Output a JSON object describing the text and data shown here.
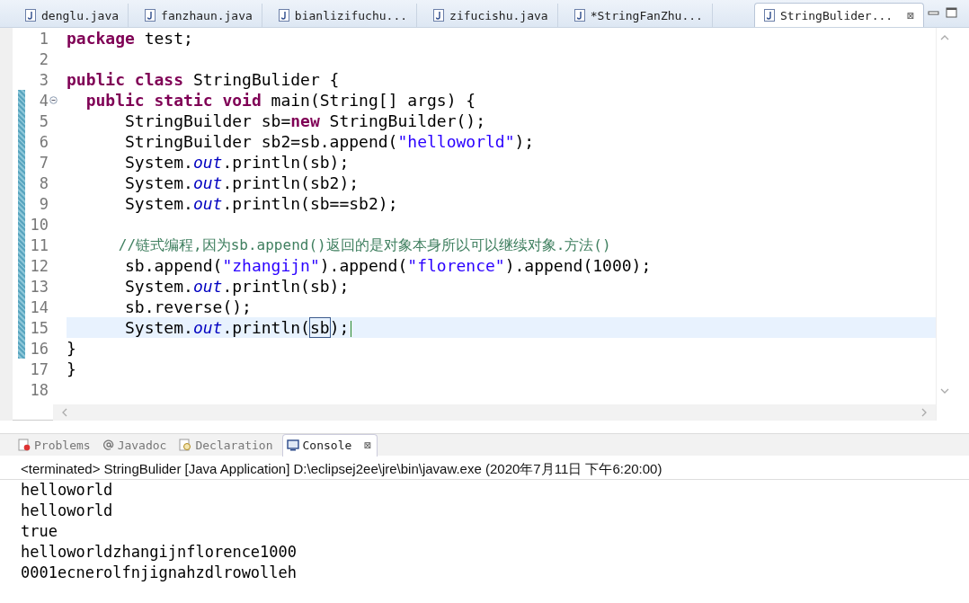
{
  "editor_tabs": [
    {
      "label": "denglu.java",
      "selected": false
    },
    {
      "label": "fanzhaun.java",
      "selected": false
    },
    {
      "label": "bianlizifuchu...",
      "selected": false
    },
    {
      "label": "zifucishu.java",
      "selected": false
    },
    {
      "label": "*StringFanZhu...",
      "selected": false
    },
    {
      "label": "StringBulider...",
      "selected": true,
      "close": "⊠"
    }
  ],
  "code_lines": [
    {
      "number": "1",
      "changed": false,
      "current": false,
      "foldable": false,
      "tokens": [
        {
          "kind": "keyword",
          "text": "package"
        },
        {
          "kind": "plain",
          "text": " test;"
        }
      ]
    },
    {
      "number": "2",
      "changed": false,
      "current": false,
      "foldable": false
    },
    {
      "number": "3",
      "changed": false,
      "current": false,
      "foldable": false,
      "tokens": [
        {
          "kind": "keyword",
          "text": "public class"
        },
        {
          "kind": "plain",
          "text": " StringBulider {"
        }
      ]
    },
    {
      "number": "4",
      "changed": true,
      "current": false,
      "foldable": true,
      "tokens": [
        {
          "kind": "keyword",
          "text": "  public static void"
        },
        {
          "kind": "plain",
          "text": " main(String[] args) {"
        }
      ]
    },
    {
      "number": "5",
      "changed": true,
      "current": false,
      "foldable": false,
      "tokens": [
        {
          "kind": "plain",
          "text": "      StringBuilder sb="
        },
        {
          "kind": "keyword",
          "text": "new"
        },
        {
          "kind": "plain",
          "text": " StringBuilder();"
        }
      ]
    },
    {
      "number": "6",
      "changed": true,
      "current": false,
      "foldable": false,
      "tokens": [
        {
          "kind": "plain",
          "text": "      StringBuilder sb2=sb.append("
        },
        {
          "kind": "string",
          "text": "\"helloworld\""
        },
        {
          "kind": "plain",
          "text": ");"
        }
      ]
    },
    {
      "number": "7",
      "changed": true,
      "current": false,
      "foldable": false,
      "tokens": [
        {
          "kind": "plain",
          "text": "      System."
        },
        {
          "kind": "field",
          "text": "out"
        },
        {
          "kind": "plain",
          "text": ".println(sb);"
        }
      ]
    },
    {
      "number": "8",
      "changed": true,
      "current": false,
      "foldable": false,
      "tokens": [
        {
          "kind": "plain",
          "text": "      System."
        },
        {
          "kind": "field",
          "text": "out"
        },
        {
          "kind": "plain",
          "text": ".println(sb2);"
        }
      ]
    },
    {
      "number": "9",
      "changed": true,
      "current": false,
      "foldable": false,
      "tokens": [
        {
          "kind": "plain",
          "text": "      System."
        },
        {
          "kind": "field",
          "text": "out"
        },
        {
          "kind": "plain",
          "text": ".println(sb==sb2);"
        }
      ]
    },
    {
      "number": "10",
      "changed": true,
      "current": false,
      "foldable": false
    },
    {
      "number": "11",
      "changed": true,
      "current": false,
      "foldable": false,
      "tokens": [
        {
          "kind": "comment",
          "text": "      //链式编程,因为sb.append()返回的是对象本身所以可以继续对象.方法()"
        }
      ]
    },
    {
      "number": "12",
      "changed": true,
      "current": false,
      "foldable": false,
      "tokens": [
        {
          "kind": "plain",
          "text": "      sb.append("
        },
        {
          "kind": "string",
          "text": "\"zhangijn\""
        },
        {
          "kind": "plain",
          "text": ").append("
        },
        {
          "kind": "string",
          "text": "\"florence\""
        },
        {
          "kind": "plain",
          "text": ").append(1000);"
        }
      ]
    },
    {
      "number": "13",
      "changed": true,
      "current": false,
      "foldable": false,
      "tokens": [
        {
          "kind": "plain",
          "text": "      System."
        },
        {
          "kind": "field",
          "text": "out"
        },
        {
          "kind": "plain",
          "text": ".println(sb);"
        }
      ]
    },
    {
      "number": "14",
      "changed": true,
      "current": false,
      "foldable": false,
      "tokens": [
        {
          "kind": "plain",
          "text": "      sb.reverse();"
        }
      ]
    },
    {
      "number": "15",
      "changed": true,
      "current": true,
      "foldable": false,
      "tokens": [
        {
          "kind": "plain",
          "text": "      System."
        },
        {
          "kind": "field",
          "text": "out"
        },
        {
          "kind": "plain",
          "text": ".println("
        },
        {
          "kind": "matched",
          "text": "sb"
        },
        {
          "kind": "plain",
          "text": ");"
        }
      ]
    },
    {
      "number": "16",
      "changed": true,
      "current": false,
      "foldable": false,
      "tokens": [
        {
          "kind": "plain",
          "text": "}"
        }
      ]
    },
    {
      "number": "17",
      "changed": false,
      "current": false,
      "foldable": false,
      "tokens": [
        {
          "kind": "plain",
          "text": "}"
        }
      ]
    },
    {
      "number": "18",
      "changed": false,
      "current": false,
      "foldable": false
    }
  ],
  "view_tabs": [
    {
      "label": "Problems",
      "kind": "problems",
      "selected": false
    },
    {
      "label": "Javadoc",
      "kind": "javadoc",
      "selected": false
    },
    {
      "label": "Declaration",
      "kind": "declaration",
      "selected": false
    },
    {
      "label": "Console",
      "kind": "console",
      "selected": true,
      "close": "⊠"
    }
  ],
  "console": {
    "status": "<terminated> StringBulider [Java Application] D:\\eclipsej2ee\\jre\\bin\\javaw.exe (2020年7月11日 下午6:20:00)",
    "output": [
      "helloworld",
      "helloworld",
      "true",
      "helloworldzhangijnflorence1000",
      "0001ecnerolfnjignahzdlrowolleh"
    ]
  }
}
